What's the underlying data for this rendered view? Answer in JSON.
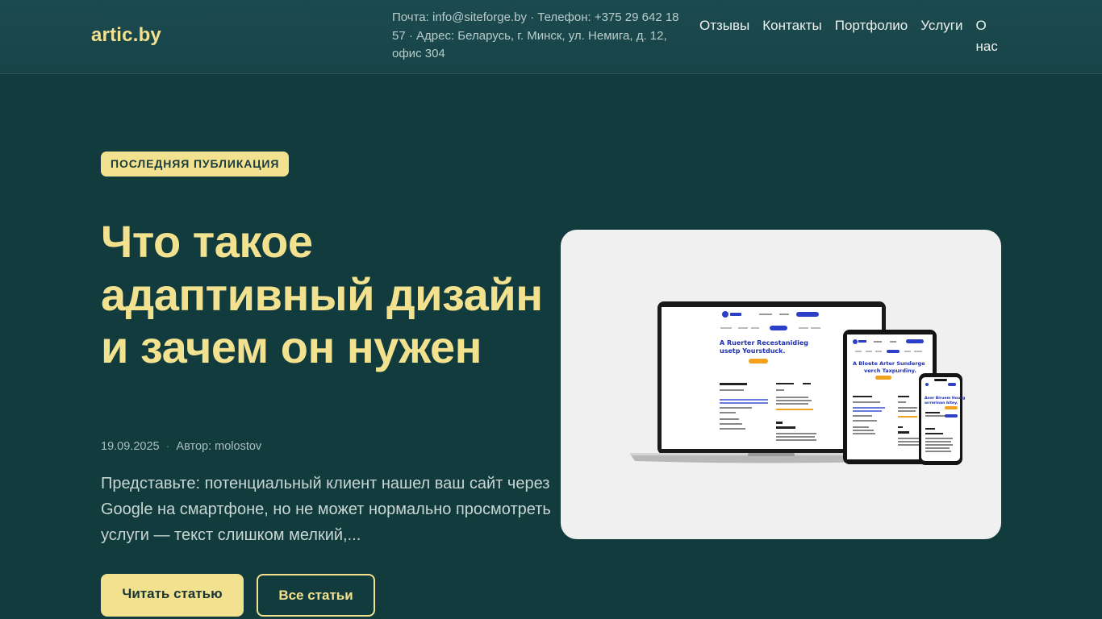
{
  "header": {
    "logo": "artic.by",
    "contacts": "Почта: info@siteforge.by · Телефон: +375 29 642 18 57 · Адрес: Беларусь, г. Минск, ул. Немига, д. 12, офис 304",
    "nav": [
      {
        "label": "Отзывы"
      },
      {
        "label": "Контакты"
      },
      {
        "label": "Портфолио"
      },
      {
        "label": "Услуги"
      },
      {
        "label": "О нас"
      }
    ]
  },
  "hero": {
    "badge": "ПОСЛЕДНЯЯ ПУБЛИКАЦИЯ",
    "title": "Что такое адаптивный дизайн и зачем он нужен",
    "date": "19.09.2025",
    "author": "Автор: molostov",
    "excerpt": "Представьте: потенциальный клиент нашел ваш сайт через Google на смартфоне, но не может нормально просмотреть услуги — текст слишком мелкий,...",
    "read_button": "Читать статью",
    "all_button": "Все статьи"
  },
  "illustration": {
    "laptop_heading_1": "A Ruerter Recestanidieg",
    "laptop_heading_2": "usetp Yourstduck.",
    "tablet_heading_1": "A Bloete Arter Sunderge",
    "tablet_heading_2": "verch Taxpurdiny.",
    "phone_heading_1": "Aner Biruem Houvg",
    "phone_heading_2": "wrrerinan bitey."
  },
  "colors": {
    "background": "#123b3d",
    "header": "#1b4a4f",
    "accent": "#f2e28f",
    "card": "#f0f0f0"
  }
}
